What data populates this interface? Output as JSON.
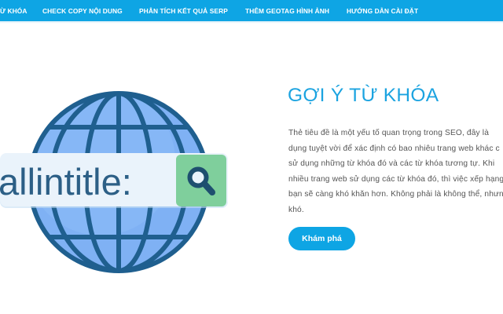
{
  "nav": {
    "items": [
      {
        "label": "Ừ KHÓA"
      },
      {
        "label": "CHECK COPY NỘI DUNG"
      },
      {
        "label": "PHÂN TÍCH KẾT QUẢ SERP"
      },
      {
        "label": "THÊM GEOTAG HÌNH ẢNH"
      },
      {
        "label": "HƯỚNG DẪN CÀI ĐẶT"
      }
    ]
  },
  "hero": {
    "search_text": "allintitle:",
    "title": "GỢI Ý TỪ KHÓA",
    "description_lines": [
      "Thẻ tiêu đề là một yếu tố quan trọng trong SEO, đây là",
      "dụng tuyệt vời để xác định có bao nhiêu trang web khác c",
      "sử dụng những từ khóa đó và các từ khóa tương tự. Khi",
      "nhiều trang web sử dụng các từ khóa đó, thì việc xếp hạng",
      "bạn sẽ càng khó khăn hơn. Không phải là không thể, nhưng",
      "khó."
    ],
    "button_label": "Khám phá"
  },
  "colors": {
    "accent": "#0ea5e4",
    "title": "#1ba3e0",
    "globe": "#7fb1f4",
    "globe_lines": "#1f5f8f",
    "search_box": "#eaf3fb",
    "search_text": "#2c5f86",
    "search_button": "#7fcf9c"
  },
  "icons": {
    "globe": "globe-icon",
    "search": "magnifier-icon"
  }
}
